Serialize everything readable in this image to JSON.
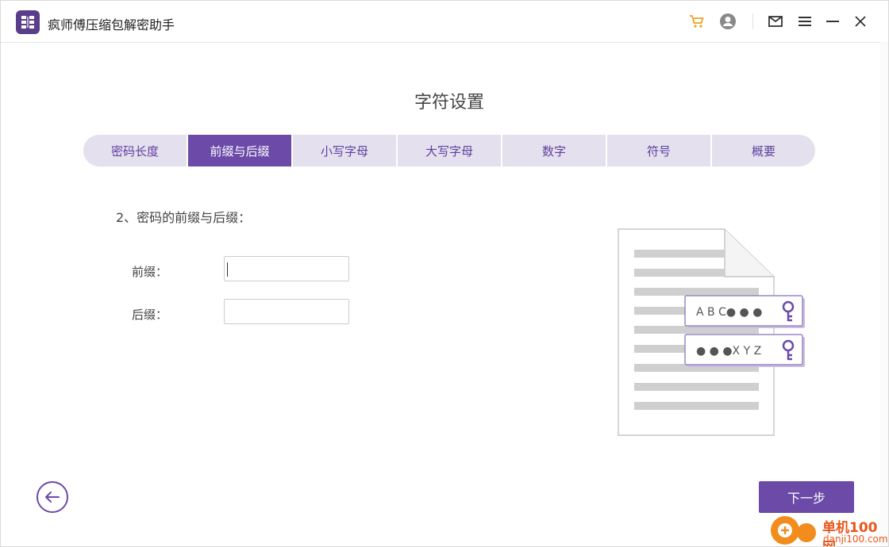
{
  "app": {
    "title": "疯师傅压缩包解密助手",
    "accent_color": "#6b4aa8",
    "tab_bg_color": "#e4e0ee"
  },
  "titlebar": {
    "icons": [
      "cart-icon",
      "user-icon",
      "mail-icon",
      "menu-icon",
      "minimize-icon",
      "close-icon"
    ],
    "cart_color": "#f0a020"
  },
  "page": {
    "title": "字符设置"
  },
  "tabs": [
    {
      "label": "密码长度",
      "active": false
    },
    {
      "label": "前缀与后缀",
      "active": true
    },
    {
      "label": "小写字母",
      "active": false
    },
    {
      "label": "大写字母",
      "active": false
    },
    {
      "label": "数字",
      "active": false
    },
    {
      "label": "符号",
      "active": false
    },
    {
      "label": "概要",
      "active": false
    }
  ],
  "form": {
    "section_label": "2、密码的前缀与后缀：",
    "prefix_label": "前缀：",
    "prefix_value": "",
    "suffix_label": "后缀：",
    "suffix_value": ""
  },
  "illustration": {
    "key_row_1": "A B C● ● ●",
    "key_row_2": "● ● ●X Y Z"
  },
  "footer": {
    "back_icon": "arrow-left-icon",
    "next_label": "下一步"
  },
  "watermark": {
    "line1": "单机100网",
    "line2": "danji100.com"
  }
}
